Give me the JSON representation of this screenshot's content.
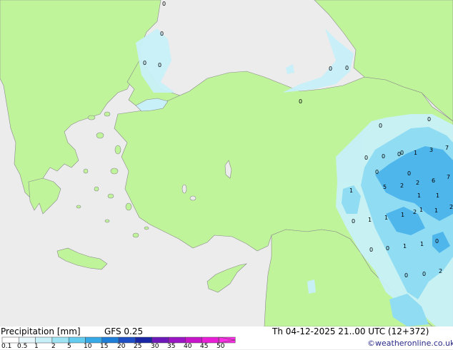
{
  "header": {
    "title": "Precipitation [mm]",
    "model": "GFS 0.25",
    "valid_time": "Th 04-12-2025 21..00 UTC (12+372)",
    "credit": "©weatheronline.co.uk"
  },
  "legend": {
    "ticks": [
      "0.1",
      "0.5",
      "1",
      "2",
      "5",
      "10",
      "15",
      "20",
      "25",
      "30",
      "35",
      "40",
      "45",
      "50"
    ],
    "colors": [
      "#ffffff",
      "#e6f7fb",
      "#c8f0f9",
      "#9de3f4",
      "#64cdef",
      "#36a9e6",
      "#1e7fd8",
      "#1f4ec5",
      "#1927a5",
      "#6d18b8",
      "#9a16c4",
      "#c715c9",
      "#e81fd6",
      "#ff2ee6"
    ]
  },
  "colors": {
    "sea": "#ececec",
    "land": "#bff49a",
    "coast": "#8a8a8a",
    "rain_light": "#c8f0f9",
    "rain_mid": "#8fdcf3",
    "rain_heavy": "#4fb6ec"
  },
  "map_values": [
    "0",
    "0",
    "0",
    "0",
    "0",
    "0",
    "0",
    "0",
    "0",
    "0",
    "0",
    "0",
    "0",
    "1",
    "3",
    "7",
    "0",
    "0",
    "5",
    "2",
    "2",
    "6",
    "7",
    "1",
    "1",
    "1",
    "2",
    "2",
    "1",
    "1",
    "0",
    "1",
    "1",
    "1",
    "0",
    "0",
    "1",
    "0",
    "1",
    "0",
    "0",
    "2"
  ]
}
